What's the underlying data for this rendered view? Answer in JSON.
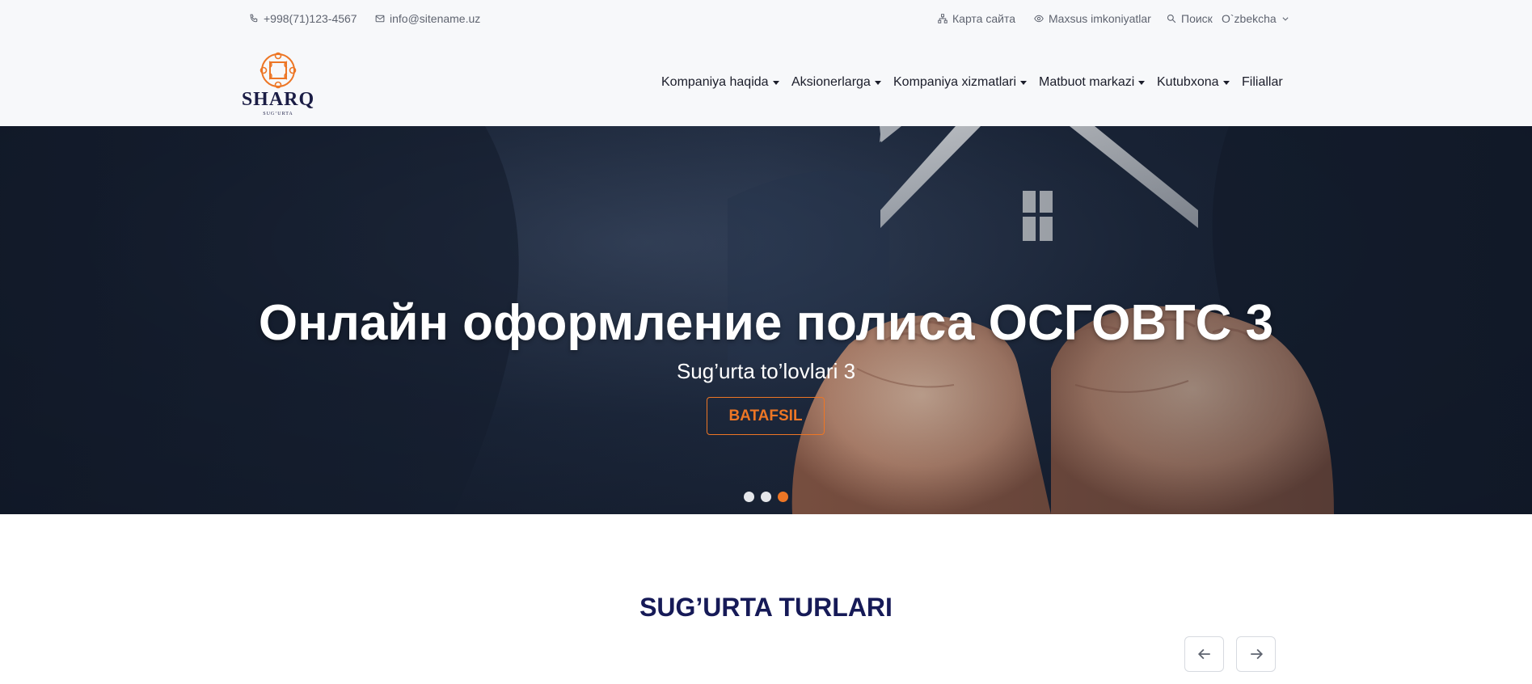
{
  "topbar": {
    "phone": "+998(71)123-4567",
    "email": "info@sitename.uz",
    "sitemap": "Карта сайта",
    "accessibility": "Maxsus imkoniyatlar",
    "search": "Поиск",
    "language": "O`zbekcha"
  },
  "logo": {
    "name": "SHARQ",
    "sub": "SUG’URTA"
  },
  "nav": {
    "items": [
      {
        "label": "Kompaniya haqida",
        "dropdown": true
      },
      {
        "label": "Aksionerlarga",
        "dropdown": true
      },
      {
        "label": "Kompaniya xizmatlari",
        "dropdown": true
      },
      {
        "label": "Matbuot markazi",
        "dropdown": true
      },
      {
        "label": "Kutubxona",
        "dropdown": true
      },
      {
        "label": "Filiallar",
        "dropdown": false
      }
    ]
  },
  "hero": {
    "title": "Онлайн оформление полиса ОСГОВТС 3",
    "subtitle": "Sug’urta to’lovlari 3",
    "button": "BATAFSIL",
    "slides": 3,
    "active_slide": 3
  },
  "section": {
    "title": "SUG’URTA TURLARI"
  },
  "colors": {
    "accent": "#ed7625",
    "brand_navy": "#161a57",
    "topbar_bg": "#f7f8fa"
  },
  "icons": {
    "phone": "phone-icon",
    "email": "mail-icon",
    "sitemap": "sitemap-icon",
    "accessibility": "eye-icon",
    "search": "search-icon",
    "language": "chevron-down-icon",
    "prev": "arrow-left-icon",
    "next": "arrow-right-icon"
  }
}
